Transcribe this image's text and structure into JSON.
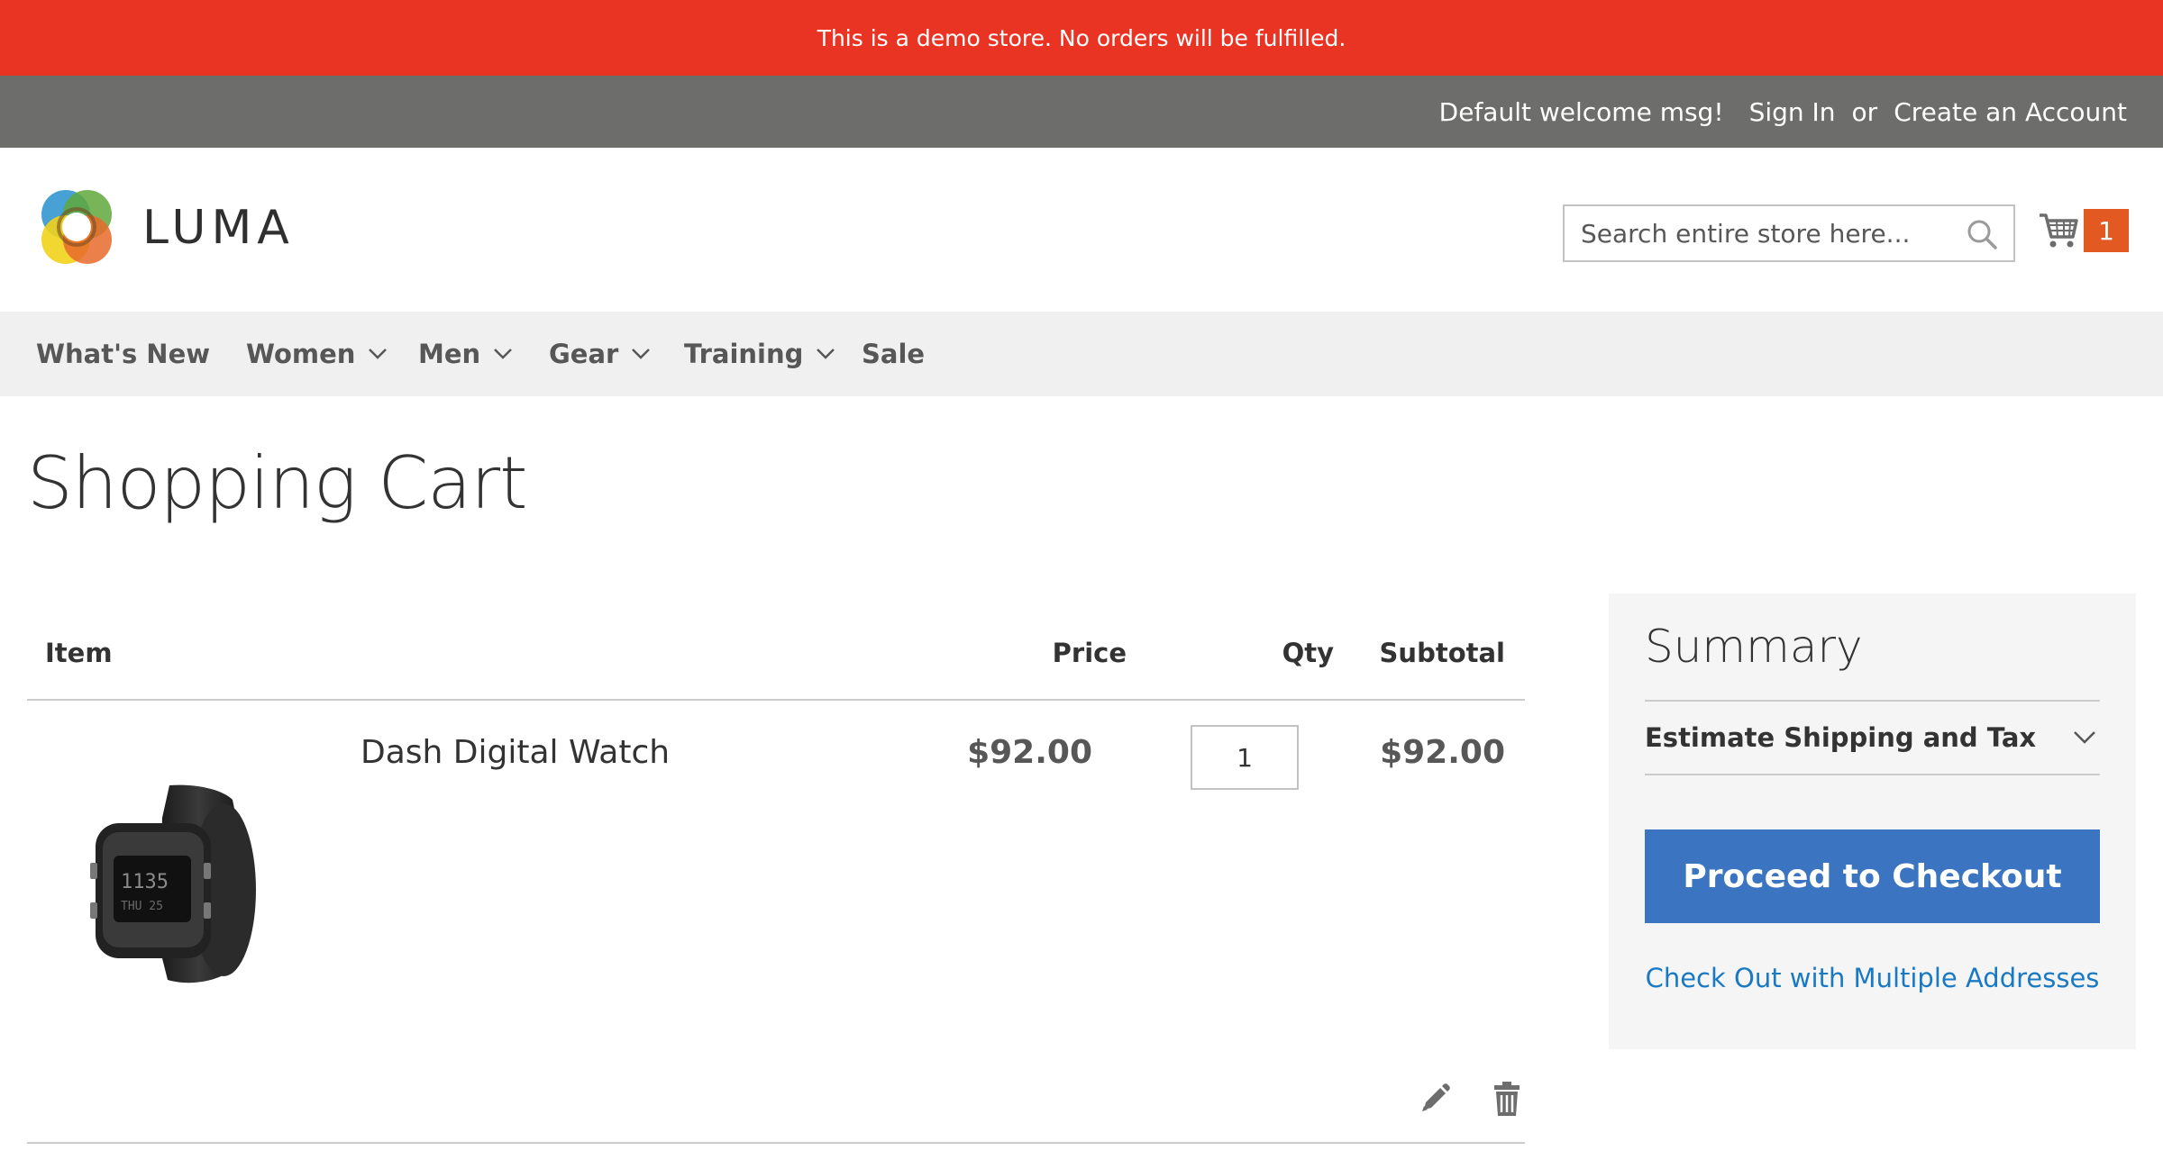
{
  "notice": {
    "text": "This is a demo store. No orders will be fulfilled."
  },
  "header_panel": {
    "welcome": "Default welcome msg!",
    "sign_in": "Sign In",
    "or": "or",
    "create_account": "Create an Account"
  },
  "logo": {
    "text": "LUMA"
  },
  "search": {
    "placeholder": "Search entire store here..."
  },
  "minicart": {
    "count": "1"
  },
  "nav": {
    "items": [
      {
        "label": "What's New",
        "has_dropdown": false
      },
      {
        "label": "Women",
        "has_dropdown": true
      },
      {
        "label": "Men",
        "has_dropdown": true
      },
      {
        "label": "Gear",
        "has_dropdown": true
      },
      {
        "label": "Training",
        "has_dropdown": true
      },
      {
        "label": "Sale",
        "has_dropdown": false
      }
    ]
  },
  "page": {
    "title": "Shopping Cart"
  },
  "cart": {
    "headers": {
      "item": "Item",
      "price": "Price",
      "qty": "Qty",
      "subtotal": "Subtotal"
    },
    "items": [
      {
        "name": "Dash Digital Watch",
        "price": "$92.00",
        "qty": "1",
        "subtotal": "$92.00"
      }
    ]
  },
  "summary": {
    "title": "Summary",
    "estimate_label": "Estimate Shipping and Tax",
    "checkout_button": "Proceed to Checkout",
    "multi_address_link": "Check Out with Multiple Addresses"
  },
  "colors": {
    "notice_bg": "#e93424",
    "panel_bg": "#6d6d6b",
    "nav_bg": "#f0f0f0",
    "cart_badge": "#e25a22",
    "checkout_button": "#3b74c0",
    "link": "#1979c3",
    "summary_bg": "#f5f5f5"
  },
  "icons": [
    "search-icon",
    "cart-icon",
    "chevron-down-icon",
    "edit-icon",
    "trash-icon"
  ]
}
